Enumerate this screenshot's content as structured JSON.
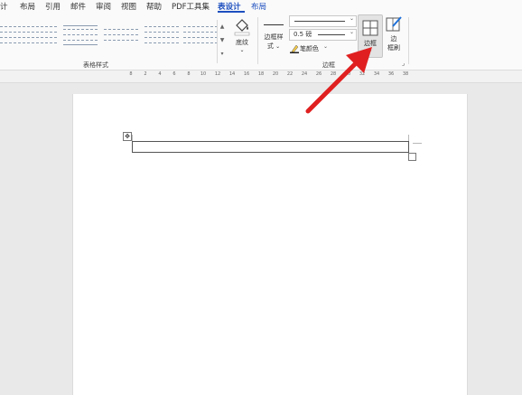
{
  "tabs": [
    {
      "label": "计",
      "active": false
    },
    {
      "label": "布局",
      "active": false
    },
    {
      "label": "引用",
      "active": false
    },
    {
      "label": "邮件",
      "active": false
    },
    {
      "label": "审阅",
      "active": false
    },
    {
      "label": "视图",
      "active": false
    },
    {
      "label": "帮助",
      "active": false
    },
    {
      "label": "PDF工具集",
      "active": false
    },
    {
      "label": "表设计",
      "active": true
    },
    {
      "label": "布局",
      "active": false
    }
  ],
  "ribbon": {
    "table_styles_label": "表格样式",
    "shading_label": "底纹",
    "border_styles_label_line1": "边框样",
    "border_styles_label_line2": "式",
    "pen_weight_value": "0.5 磅",
    "pen_color_label": "笔颜色",
    "borders_button_label": "边框",
    "border_painter_label_line1": "边",
    "border_painter_label_line2": "框刷",
    "borders_group_label": "边框"
  },
  "ruler": {
    "ticks": [
      "8",
      "2",
      "4",
      "6",
      "8",
      "10",
      "12",
      "14",
      "16",
      "18",
      "20",
      "22",
      "24",
      "26",
      "28",
      "30",
      "32",
      "34",
      "36",
      "38"
    ]
  },
  "colors": {
    "accent_blue": "#1d4fbf",
    "arrow_red": "#e02020",
    "pen_color_swatch": "#1f1f1f"
  },
  "icons": [
    "table-move-handle-icon",
    "table-resize-handle-icon",
    "shading-bucket-icon",
    "borders-icon",
    "border-painter-icon",
    "red-annotation-arrow"
  ]
}
